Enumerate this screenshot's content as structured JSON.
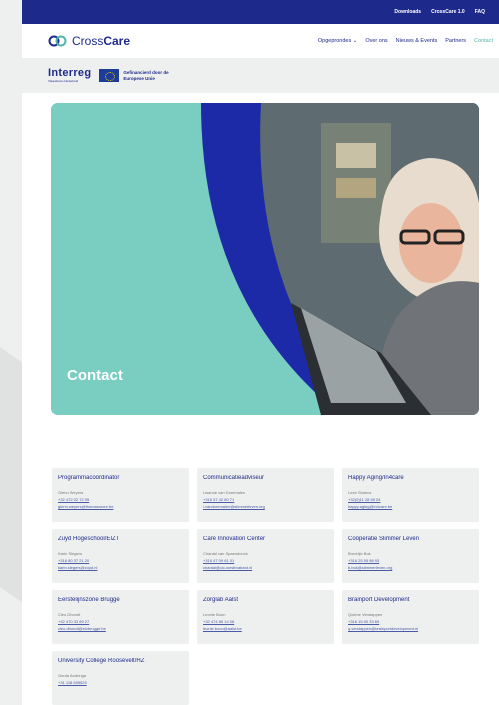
{
  "topbar": {
    "links": [
      "Downloads",
      "CrossCare 1.0",
      "FAQ"
    ]
  },
  "brand": {
    "name_light": "Cross",
    "name_bold": "Care"
  },
  "nav": {
    "items": [
      "Opgeprondes ⌄",
      "Over ons",
      "Nieuws & Events",
      "Partners",
      "Contact"
    ],
    "active_index": 4
  },
  "interreg": {
    "title": "Interreg",
    "subtitle": "Vlaanderen-Nederland",
    "eu_text": "Gefinancierd door de Europese Unie"
  },
  "hero": {
    "title": "Contact"
  },
  "colors": {
    "navy": "#1d2a8c",
    "teal": "#79cdc1",
    "accent": "#4fb6a8"
  },
  "contacts": [
    {
      "title": "Programmacoördinator",
      "name": "Glenn Weyers",
      "phone": "+32 472 02 72 95",
      "email": "glenn.weyers@thomasmore.be"
    },
    {
      "title": "Communicatieadviseur",
      "name": "Lisanne van Doremalen",
      "phone": "+316 57 42 80 71",
      "email": "l.vandoremalen@slimmerleven.org"
    },
    {
      "title": "Happy Aging/In4care",
      "name": "Leen Stulens",
      "phone": "+32(0)11 28 69 04",
      "email": "happy.aging@in4care.be"
    },
    {
      "title": "Zuyd Hogeschool/EIZT",
      "name": "Karin Slegers",
      "phone": "+316 80 37 21 20",
      "email": "karin.slegers@zuyd.nl"
    },
    {
      "title": "Care Innovation Center",
      "name": "Chantal van Spaendonck",
      "phone": "+316 47 09 61 01",
      "email": "chantal@cic-westbrabant.nl"
    },
    {
      "title": "Coöperatie Slimmer Leven",
      "name": "Brechtje Bok",
      "phone": "+316 25 55 86 93",
      "email": "b.bok@slimmerleven.org"
    },
    {
      "title": "Eerstelijnszone Brugge",
      "name": "Cleo Dhondt",
      "phone": "+32 470 33 89 27",
      "email": "cleo.dhondt@elzbrugge.be"
    },
    {
      "title": "Zorglab Aalst",
      "name": "Leonie Boon",
      "phone": "+32 474 85 14 06",
      "email": "leonie.boon@aalst.be"
    },
    {
      "title": "Brainport Development",
      "name": "Quirine Verstappen",
      "phone": "+316 15 90 33 65",
      "email": "q.verstappen@brainportdevelopment.nl"
    },
    {
      "title": "University College Roosevelt/HZ",
      "name": "Gerda Andringa",
      "phone": "+31 118 655529",
      "email": ""
    }
  ]
}
